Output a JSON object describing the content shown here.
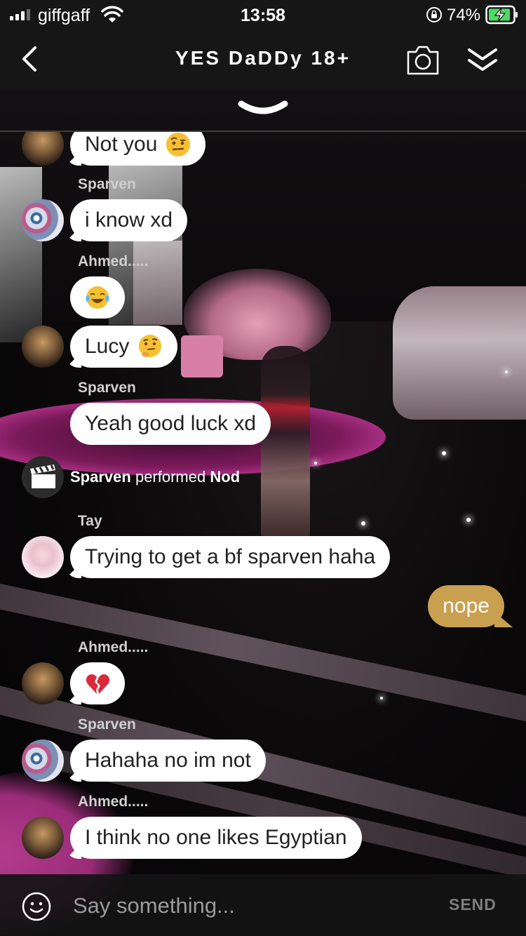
{
  "status_bar": {
    "carrier": "giffgaff",
    "time": "13:58",
    "battery": "74%",
    "icons": [
      "signal-icon",
      "wifi-icon",
      "rotation-lock-icon",
      "battery-charging-icon"
    ]
  },
  "nav": {
    "title": "YES DaDDy 18+",
    "icons": [
      "back-icon",
      "camera-icon",
      "collapse-icon"
    ]
  },
  "chat": {
    "messages": [
      {
        "sender": "",
        "text": "Not you",
        "emoji": "raised-eyebrow-emoji"
      },
      {
        "sender": "Sparven",
        "text": "i know xd"
      },
      {
        "sender": "Ahmed.....",
        "text": "",
        "emoji": "tears-of-joy-emoji"
      },
      {
        "sender": "",
        "text": "Lucy",
        "emoji": "thinking-emoji"
      },
      {
        "sender": "Sparven",
        "text": "Yeah good luck xd"
      },
      {
        "action": {
          "actor": "Sparven",
          "verb": "performed",
          "object": "Nod"
        }
      },
      {
        "sender": "Tay",
        "text": "Trying to get a bf sparven haha"
      },
      {
        "sender": "me",
        "text": "nope",
        "own": true
      },
      {
        "sender": "Ahmed.....",
        "text": "",
        "emoji": "broken-heart-emoji"
      },
      {
        "sender": "Sparven",
        "text": "Hahaha no im not"
      },
      {
        "sender": "Ahmed.....",
        "text": "I think no one likes Egyptian"
      }
    ]
  },
  "input": {
    "placeholder": "Say something...",
    "send_label": "SEND"
  },
  "colors": {
    "own_bubble": "#c9a050",
    "other_bubble": "#ffffff",
    "bar_bg": "#161616"
  }
}
